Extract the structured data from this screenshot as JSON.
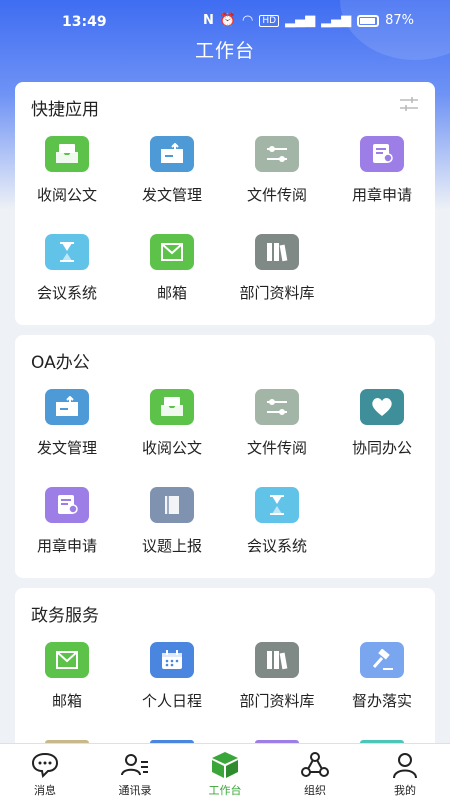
{
  "status_bar": {
    "time": "13:49",
    "battery": "87%",
    "hd": "HD"
  },
  "header": {
    "title": "工作台"
  },
  "sections": [
    {
      "title": "快捷应用",
      "items": [
        {
          "label": "收阅公文",
          "icon": "inbox-icon",
          "color": "#5cc24a"
        },
        {
          "label": "发文管理",
          "icon": "outbox-icon",
          "color": "#4e9ad6"
        },
        {
          "label": "文件传阅",
          "icon": "toggle-icon",
          "color": "#a3b5a6"
        },
        {
          "label": "用章申请",
          "icon": "seal-request-icon",
          "color": "#9c7ee6"
        },
        {
          "label": "会议系统",
          "icon": "hourglass-icon",
          "color": "#62c3e9"
        },
        {
          "label": "邮箱",
          "icon": "mail-icon",
          "color": "#5cc24a"
        },
        {
          "label": "部门资料库",
          "icon": "binders-icon",
          "color": "#7f8a86"
        }
      ]
    },
    {
      "title": "OA办公",
      "items": [
        {
          "label": "发文管理",
          "icon": "outbox-icon",
          "color": "#4e9ad6"
        },
        {
          "label": "收阅公文",
          "icon": "inbox-icon",
          "color": "#5cc24a"
        },
        {
          "label": "文件传阅",
          "icon": "toggle-icon",
          "color": "#a3b5a6"
        },
        {
          "label": "协同办公",
          "icon": "heart-icon",
          "color": "#3f8f9a"
        },
        {
          "label": "用章申请",
          "icon": "seal-request-icon",
          "color": "#9c7ee6"
        },
        {
          "label": "议题上报",
          "icon": "book-icon",
          "color": "#7f92b0"
        },
        {
          "label": "会议系统",
          "icon": "hourglass-icon",
          "color": "#62c3e9"
        }
      ]
    },
    {
      "title": "政务服务",
      "items": [
        {
          "label": "邮箱",
          "icon": "mail-icon",
          "color": "#5cc24a"
        },
        {
          "label": "个人日程",
          "icon": "calendar-icon",
          "color": "#4a86e0"
        },
        {
          "label": "部门资料库",
          "icon": "binders-icon",
          "color": "#7f8a86"
        },
        {
          "label": "督办落实",
          "icon": "gavel-icon",
          "color": "#7aa6ef"
        }
      ]
    }
  ],
  "peek_colors": [
    "#c8b98a",
    "#4a86e0",
    "#9c7ee6",
    "#4cc6b8"
  ],
  "nav": {
    "items": [
      {
        "label": "消息",
        "icon": "chat-icon"
      },
      {
        "label": "通讯录",
        "icon": "contacts-icon"
      },
      {
        "label": "工作台",
        "icon": "workbench-icon",
        "active": true
      },
      {
        "label": "组织",
        "icon": "organization-icon"
      },
      {
        "label": "我的",
        "icon": "profile-icon"
      }
    ],
    "active_color": "#3aa63a"
  }
}
